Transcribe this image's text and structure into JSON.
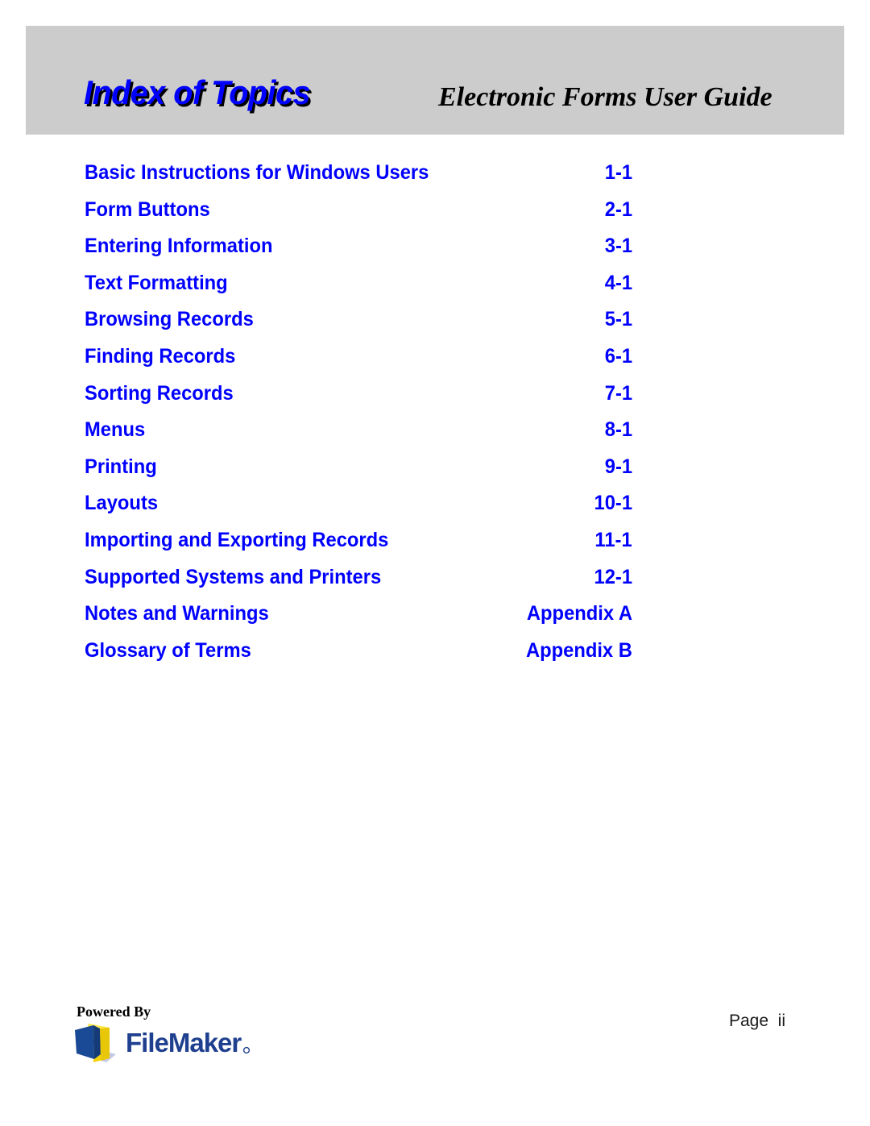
{
  "header": {
    "title": "Index of Topics",
    "subtitle": "Electronic Forms User Guide",
    "band_color": "#cccccc",
    "title_color": "#0000ff",
    "title_shadow_color": "#000000",
    "subtitle_color": "#000000"
  },
  "index": {
    "entry_color": "#0000ff",
    "entries": [
      {
        "topic": "Basic Instructions for Windows Users",
        "page": "1-1"
      },
      {
        "topic": "Form Buttons",
        "page": "2-1"
      },
      {
        "topic": "Entering Information",
        "page": "3-1"
      },
      {
        "topic": "Text Formatting",
        "page": "4-1"
      },
      {
        "topic": "Browsing Records",
        "page": "5-1"
      },
      {
        "topic": "Finding Records",
        "page": "6-1"
      },
      {
        "topic": "Sorting Records",
        "page": "7-1"
      },
      {
        "topic": "Menus",
        "page": "8-1"
      },
      {
        "topic": "Printing",
        "page": "9-1"
      },
      {
        "topic": "Layouts",
        "page": "10-1"
      },
      {
        "topic": "Importing and Exporting Records",
        "page": "11-1"
      },
      {
        "topic": "Supported Systems and Printers",
        "page": "12-1"
      },
      {
        "topic": "Notes and Warnings",
        "page": "Appendix A"
      },
      {
        "topic": "Glossary of Terms",
        "page": "Appendix B"
      }
    ]
  },
  "footer": {
    "powered_by_label": "Powered By",
    "brand_name": "FileMaker",
    "brand_registered_mark": "®",
    "brand_color": "#1f3f8f",
    "folder_icon_name": "filemaker-folder-icon",
    "folder_yellow": "#f5d30a",
    "folder_blue": "#1a4a96",
    "folder_shadow": "#c6c9e6",
    "page_label": "Page  ii"
  }
}
